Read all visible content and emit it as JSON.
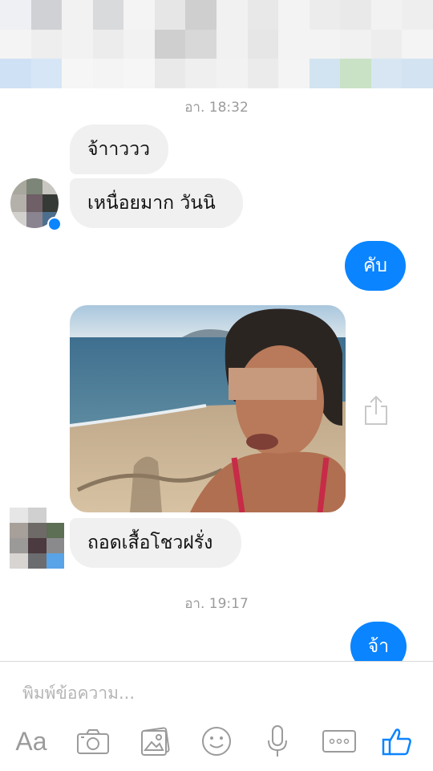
{
  "header": {
    "pixel_colors": [
      "#eef0f4",
      "#cfd1d4",
      "#f2f2f2",
      "#d9dadc",
      "#f4f4f4",
      "#e6e6e6",
      "#cfcfcf",
      "#f1f1f1",
      "#e8e8e8",
      "#f3f3f3",
      "#ececec",
      "#e9e9e9",
      "#f2f2f2",
      "#eeeeee",
      "#f4f4f4",
      "#eeeeee",
      "#f2f2f2",
      "#ececec",
      "#f2f2f2",
      "#cfcfcf",
      "#d8d8d8",
      "#f1f1f1",
      "#e6e6e6",
      "#f3f3f3",
      "#f3f3f3",
      "#f1f1f1",
      "#ededed",
      "#f4f4f4",
      "#cfe1f4",
      "#d6e6f6",
      "#f6f6f6",
      "#f4f4f4",
      "#f6f6f6",
      "#e9e9e9",
      "#efefef",
      "#f2f2f2",
      "#ebebeb",
      "#f4f4f4",
      "#d2e4f1",
      "#c9e2c6",
      "#d8e6f3",
      "#d3e3f2"
    ]
  },
  "messages": {
    "time1": "อา. 18:32",
    "in1": "จ้าาววว",
    "in2": "เหนื่อยมาก วันนิ",
    "out1": "คับ",
    "in3": "ถอดเสื้อโชวฝรั่ง",
    "time2": "อา. 19:17",
    "out2": "จ้า"
  },
  "composer": {
    "placeholder": "พิมพ์ข้อความ..."
  },
  "toolbar": {
    "aa_label": "Aa",
    "icons": [
      "camera-icon",
      "gallery-icon",
      "emoji-icon",
      "microphone-icon",
      "more-icon",
      "like-icon"
    ]
  },
  "colors": {
    "accent": "#0a84ff",
    "incoming_bubble": "#f0f0f0",
    "timestamp": "#9b9b9b"
  }
}
